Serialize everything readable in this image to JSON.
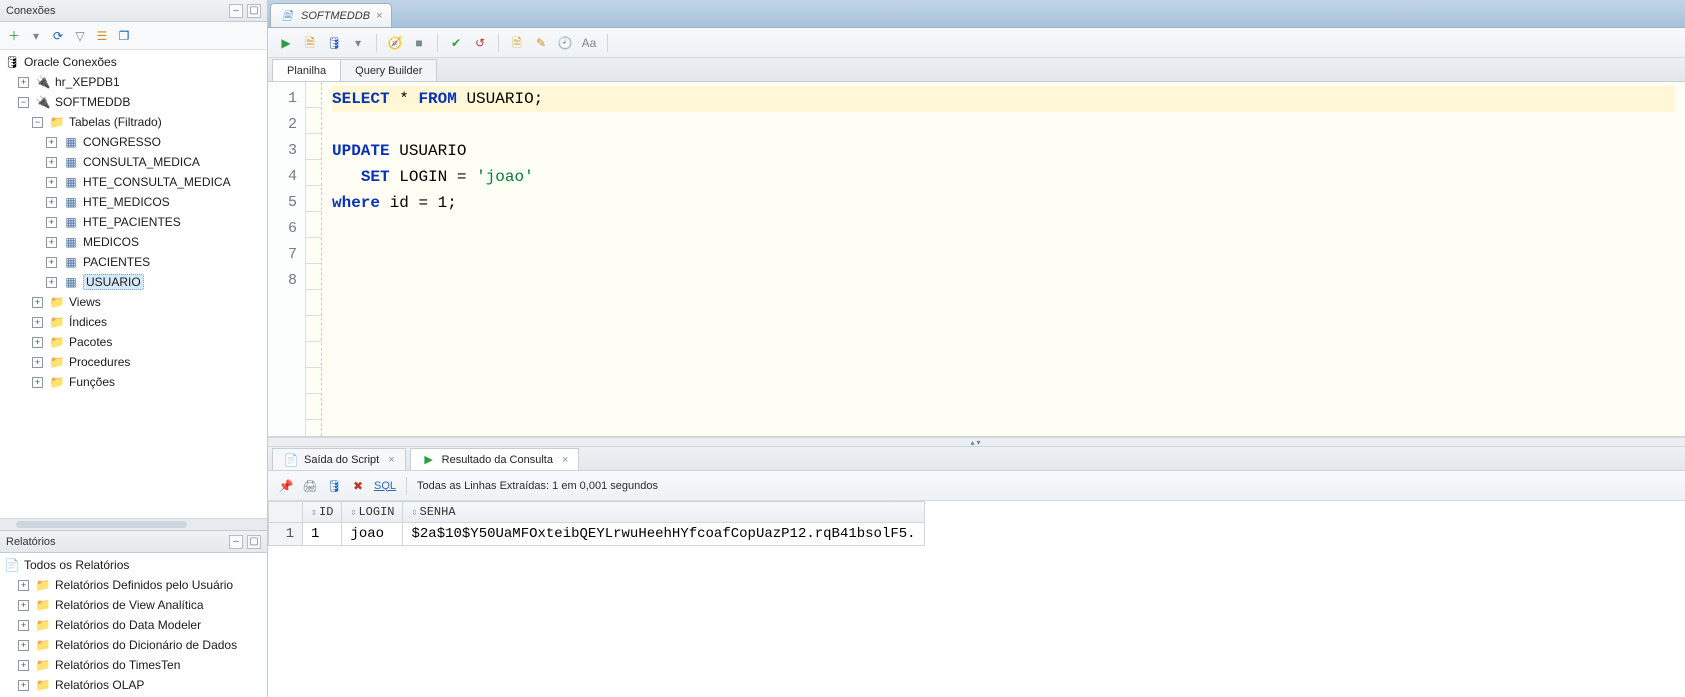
{
  "left": {
    "connections_title": "Conexões",
    "root": "Oracle Conexões",
    "db1": "hr_XEPDB1",
    "db2": "SOFTMEDDB",
    "tables_label": "Tabelas (Filtrado)",
    "tables": [
      "CONGRESSO",
      "CONSULTA_MEDICA",
      "HTE_CONSULTA_MEDICA",
      "HTE_MEDICOS",
      "HTE_PACIENTES",
      "MEDICOS",
      "PACIENTES",
      "USUARIO"
    ],
    "folders": {
      "views": "Views",
      "indices": "Índices",
      "pacotes": "Pacotes",
      "procedures": "Procedures",
      "funcoes": "Funções"
    },
    "reports_title": "Relatórios",
    "reports_root": "Todos os Relatórios",
    "reports_items": [
      "Relatórios Definidos pelo Usuário",
      "Relatórios de View Analítica",
      "Relatórios do Data Modeler",
      "Relatórios do Dicionário de Dados",
      "Relatórios do TimesTen",
      "Relatórios OLAP"
    ]
  },
  "tabs": {
    "file_tab": "SOFTMEDDB",
    "worksheet": "Planilha",
    "query_builder": "Query Builder"
  },
  "editor": {
    "tokens": {
      "select": "SELECT",
      "star": "*",
      "from": "FROM",
      "usuario": "USUARIO",
      "semi": ";",
      "update": "UPDATE",
      "set": "SET",
      "login_col": "LOGIN",
      "eq": "=",
      "joao_str": "'joao'",
      "where": "where",
      "id_col": "id",
      "one": "1"
    },
    "gutter": [
      "1",
      "2",
      "3",
      "4",
      "5",
      "6",
      "7",
      "8"
    ]
  },
  "results": {
    "tab_script": "Saída do Script",
    "tab_query": "Resultado da Consulta",
    "sql_link": "SQL",
    "status": "Todas as Linhas Extraídas: 1 em 0,001 segundos",
    "columns": [
      "ID",
      "LOGIN",
      "SENHA"
    ],
    "rows": [
      {
        "n": "1",
        "ID": "1",
        "LOGIN": "joao",
        "SENHA": "$2a$10$Y50UaMFOxteibQEYLrwuHeehHYfcoafCopUazP12.rqB41bsolF5."
      }
    ]
  }
}
